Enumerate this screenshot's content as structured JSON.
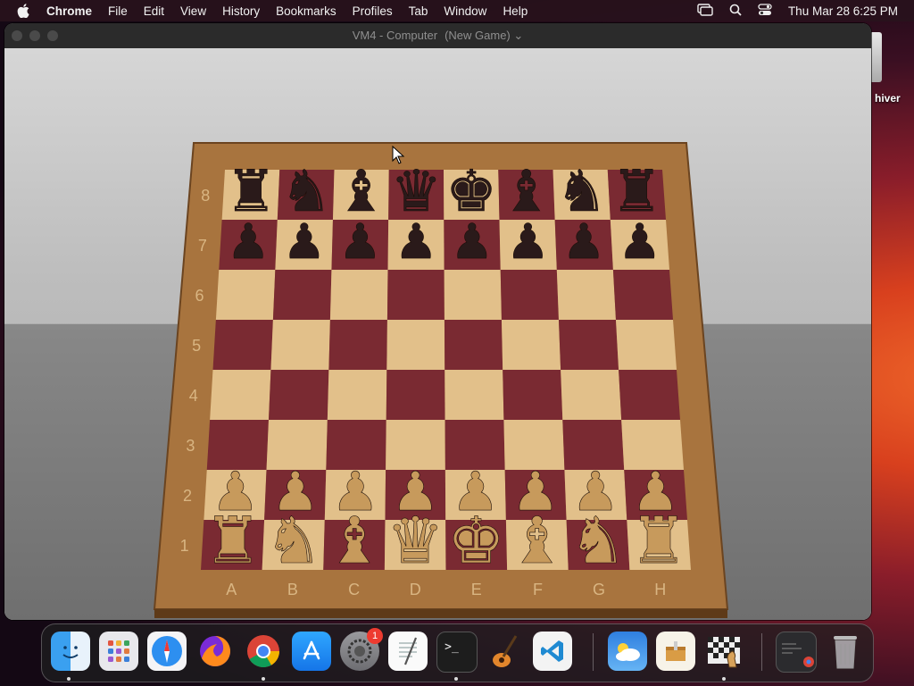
{
  "menubar": {
    "app_name": "Chrome",
    "items": [
      "File",
      "Edit",
      "View",
      "History",
      "Bookmarks",
      "Profiles",
      "Tab",
      "Window",
      "Help"
    ],
    "clock": "Thu Mar 28  6:25 PM"
  },
  "desktop": {
    "icon_label": "hiver"
  },
  "window": {
    "title": "VM4 - Computer",
    "subtitle": "(New Game)"
  },
  "board": {
    "rank_labels": [
      "8",
      "7",
      "6",
      "5",
      "4",
      "3",
      "2",
      "1"
    ],
    "file_labels": [
      "A",
      "B",
      "C",
      "D",
      "E",
      "F",
      "G",
      "H"
    ],
    "colors": {
      "light": "#e2c08a",
      "dark": "#7a2a32",
      "frame": "#a8743e",
      "black_piece": "#2a1a1a",
      "white_piece": "#c79a5c"
    },
    "pieces": {
      "black_back": [
        "♜",
        "♞",
        "♝",
        "♛",
        "♚",
        "♝",
        "♞",
        "♜"
      ],
      "black_pawn": "♟",
      "white_back": [
        "♜",
        "♞",
        "♝",
        "♛",
        "♚",
        "♝",
        "♞",
        "♜"
      ],
      "white_pawn": "♟"
    }
  },
  "dock": {
    "settings_badge": "1",
    "apps": [
      "finder",
      "launchpad",
      "safari",
      "firefox",
      "chrome",
      "app-store",
      "system-settings",
      "textedit",
      "terminal",
      "garageband",
      "vscode",
      "weather",
      "archive",
      "chess",
      "screenshot",
      "trash"
    ]
  }
}
